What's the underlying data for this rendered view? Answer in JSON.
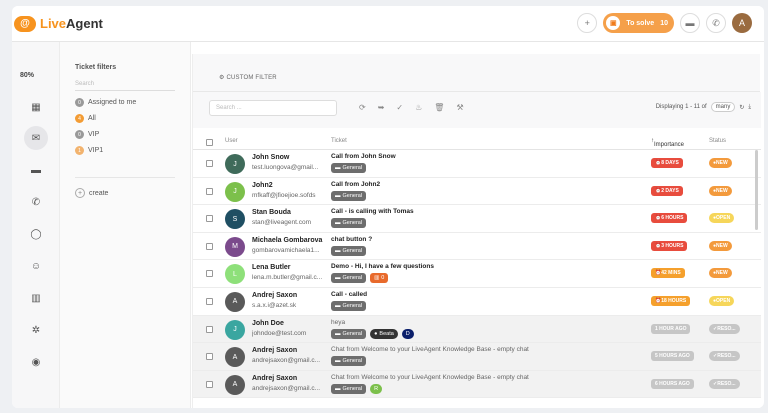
{
  "app": {
    "name_part1": "Live",
    "name_part2": "Agent",
    "logo_letter": "@"
  },
  "topbar": {
    "to_solve_label": "To solve",
    "to_solve_count": "10",
    "avatar_letter": "A"
  },
  "leftnav": {
    "zoom": "80%"
  },
  "filters": {
    "title": "Ticket filters",
    "search_placeholder": "Search",
    "items": [
      {
        "badge": "0",
        "label": "Assigned to me"
      },
      {
        "badge": "4",
        "label": "All"
      },
      {
        "badge": "0",
        "label": "VIP"
      },
      {
        "badge": "1",
        "label": "VIP1"
      }
    ],
    "create_label": "create"
  },
  "main": {
    "custom_filter": "CUSTOM FILTER",
    "search_placeholder": "Search ...",
    "displaying": "Displaying 1 - 11 of",
    "many": "many",
    "columns": {
      "user": "User",
      "ticket": "Ticket",
      "importance": "Importance",
      "status": "Status"
    }
  },
  "tickets": [
    {
      "name": "John Snow",
      "email": "test.luongova@gmail...",
      "subject": "Call from John Snow",
      "tags": [
        "General"
      ],
      "importance": "8 DAYS",
      "status": "NEW",
      "avatar": "J"
    },
    {
      "name": "John2",
      "email": "mfkaff@jfioejioe.sofds",
      "subject": "Call from John2",
      "tags": [
        "General"
      ],
      "importance": "2 DAYS",
      "status": "NEW",
      "avatar": "J"
    },
    {
      "name": "Stan Bouda",
      "email": "stan@liveagent.com",
      "subject": "Call - is calling with Tomas",
      "tags": [
        "General"
      ],
      "importance": "6 HOURS",
      "status": "OPEN",
      "avatar": "S"
    },
    {
      "name": "Michaela Gombarova",
      "email": "gombarovamichaela1...",
      "subject": "chat button ?",
      "tags": [
        "General"
      ],
      "importance": "3 HOURS",
      "status": "NEW",
      "avatar": "M"
    },
    {
      "name": "Lena Butler",
      "email": "lena.m.butler@gmail.c...",
      "subject": "Demo - Hi, I have a few questions",
      "tags": [
        "General",
        "0"
      ],
      "importance": "42 MINS",
      "status": "NEW",
      "avatar": "L"
    },
    {
      "name": "Andrej Saxon",
      "email": "s.a.x.i@azet.sk",
      "subject": "Call - called",
      "tags": [
        "General"
      ],
      "importance": "18 HOURS",
      "status": "OPEN",
      "avatar": "A"
    },
    {
      "name": "John Doe",
      "email": "johndoe@test.com",
      "subject": "heya",
      "tags": [
        "General",
        "Beata",
        "D"
      ],
      "importance": "1 HOUR AGO",
      "status": "RESO...",
      "avatar": "J"
    },
    {
      "name": "Andrej Saxon",
      "email": "andrejsaxon@gmail.c...",
      "subject": "Chat from Welcome to your LiveAgent Knowledge Base - empty chat",
      "tags": [
        "General"
      ],
      "importance": "5 HOURS AGO",
      "status": "RESO...",
      "avatar": "A"
    },
    {
      "name": "Andrej Saxon",
      "email": "andrejsaxon@gmail.c...",
      "subject": "Chat from Welcome to your LiveAgent Knowledge Base - empty chat",
      "tags": [
        "General",
        "R"
      ],
      "importance": "6 HOURS AGO",
      "status": "RESO...",
      "avatar": "A"
    }
  ],
  "colors": {
    "brand": "#f7931e",
    "red_badge": "#e84c3d",
    "orange_badge": "#f5a02c",
    "open_badge": "#f6d65a",
    "resolved_badge": "#c6c6c6"
  }
}
